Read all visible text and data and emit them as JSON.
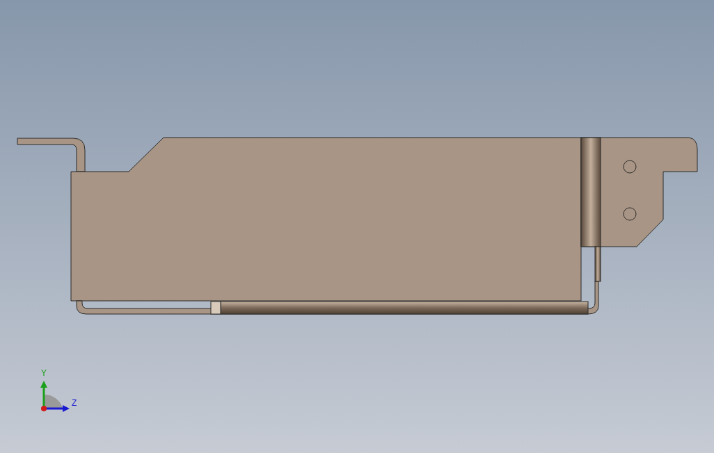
{
  "viewport": {
    "triad": {
      "axes": [
        {
          "label": "Y",
          "color": "#1aa01a"
        },
        {
          "label": "Z",
          "color": "#1a1ad0"
        }
      ]
    }
  }
}
